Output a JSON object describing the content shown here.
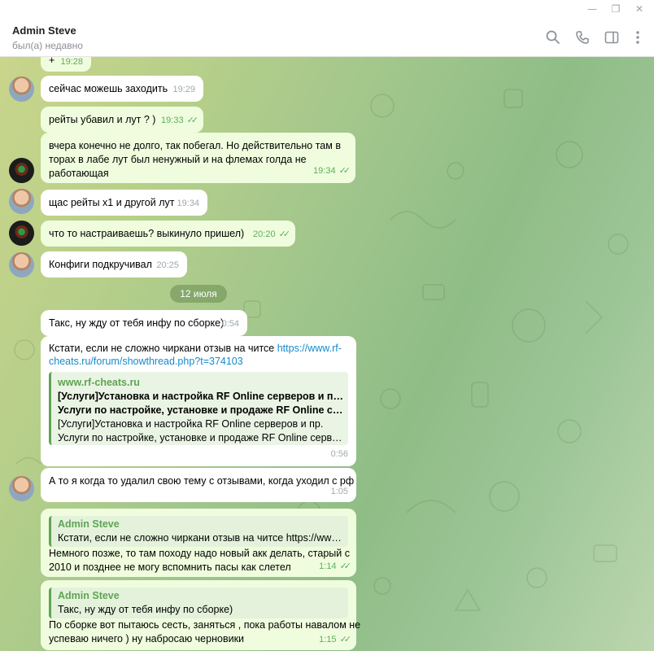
{
  "window": {
    "minimize": "—",
    "maximize": "❐",
    "close": "✕"
  },
  "header": {
    "name": "Admin Steve",
    "status": "был(а) недавно"
  },
  "messages": [
    {
      "text": "+",
      "time": "19:28"
    },
    {
      "text": "сейчас можешь заходить",
      "time": "19:29"
    },
    {
      "text": "рейты убавил и лут ? )",
      "time": "19:33"
    },
    {
      "text": "вчера конечно не долго, так побегал. Но действительно там в\nторах в лабе лут был ненужный и на флемах голда не\nработающая",
      "time": "19:34"
    },
    {
      "text": "щас рейты х1 и другой лут",
      "time": "19:34"
    },
    {
      "text": "что то настраиваешь? выкинуло пришел)",
      "time": "20:20"
    },
    {
      "text": "Конфиги подкручивал",
      "time": "20:25"
    },
    {
      "text": "Такс, ну жду от тебя инфу по сборке)",
      "time": "0:54"
    },
    {
      "text_before_link": "Кстати, если не сложно чиркани отзыв на читсе ",
      "link_part1": "https://www.rf-",
      "link_part2": "cheats.ru/forum/showthread.php?t=374103",
      "preview_site": "www.rf-cheats.ru",
      "preview_title1": "[Услуги]Установка и настройка RF Online серверов и пр. -",
      "preview_title2": "Услуги по настройке, установке и продаже RF Online серве…",
      "preview_desc1": "[Услуги]Установка и настройка RF Online серверов и пр.",
      "preview_desc2": "Услуги по настройке, установке и продаже RF Online серверо…",
      "time": "0:56"
    },
    {
      "text": "А то я когда то удалил свою тему с отзывами, когда уходил с рф",
      "time": "1:05"
    },
    {
      "reply_name": "Admin Steve",
      "reply_text": "Кстати, если не сложно чиркани отзыв на читсе https://www.r…",
      "text": "Немного позже, то там походу надо новый акк делать, старый с\n2010 и позднее не могу вспомнить пасы как слетел",
      "time": "1:14"
    },
    {
      "reply_name": "Admin Steve",
      "reply_text": "Такс, ну жду от тебя инфу по сборке)",
      "text": "По сборке вот пытаюсь сесть, заняться , пока работы навалом не\nуспеваю ничего ) ну набросаю черновики",
      "time": "1:15"
    }
  ],
  "date_divider": "12 июля",
  "ticks_glyph": "✓✓"
}
